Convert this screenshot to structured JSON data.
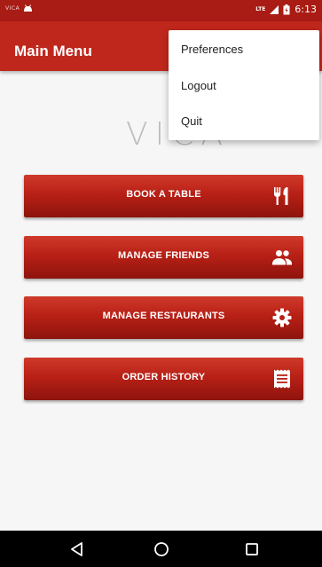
{
  "status_bar": {
    "app_name": "VICA",
    "network": "LTE",
    "time": "6:13"
  },
  "app_bar": {
    "title": "Main Menu"
  },
  "logo_text": "VICA",
  "menu_buttons": [
    {
      "label": "BOOK A TABLE",
      "icon": "utensils-icon"
    },
    {
      "label": "MANAGE FRIENDS",
      "icon": "people-icon"
    },
    {
      "label": "MANAGE RESTAURANTS",
      "icon": "gear-icon"
    },
    {
      "label": "ORDER HISTORY",
      "icon": "receipt-icon"
    }
  ],
  "overflow_menu": {
    "items": [
      "Preferences",
      "Logout",
      "Quit"
    ]
  },
  "nav_bar": {
    "icons": [
      "back-icon",
      "home-icon",
      "recents-icon"
    ]
  },
  "colors": {
    "primary": "#c0271c",
    "status_bar": "#a81c15",
    "button_top": "#cf3a2a",
    "button_bottom": "#8d140d"
  }
}
